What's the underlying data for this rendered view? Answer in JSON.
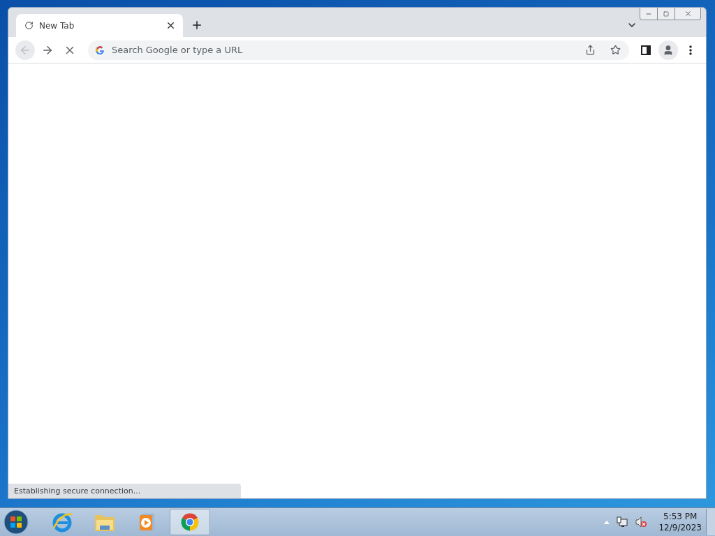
{
  "browser": {
    "tabs": [
      {
        "title": "New Tab",
        "selected": true
      }
    ],
    "toolbar": {
      "back_disabled": true,
      "loading": true,
      "omnibox": {
        "placeholder": "Search Google or type a URL"
      }
    },
    "status_bubble": "Establishing secure connection..."
  },
  "taskbar": {
    "apps": [
      {
        "kind": "ie",
        "selected": false
      },
      {
        "kind": "explorer",
        "selected": false
      },
      {
        "kind": "media",
        "selected": false
      },
      {
        "kind": "chrome",
        "selected": true
      }
    ],
    "tray": {
      "volume_muted": true
    },
    "clock": {
      "time": "5:53 PM",
      "date": "12/9/2023"
    }
  }
}
